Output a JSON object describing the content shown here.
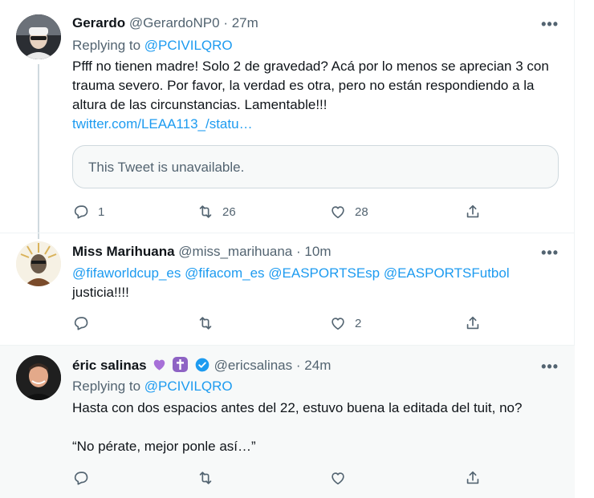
{
  "tweets": [
    {
      "name": "Gerardo",
      "handle": "@GerardoNP0",
      "time": "27m",
      "dot": "·",
      "more": "•••",
      "replying_label": "Replying to",
      "replying_to": "@PCIVILQRO",
      "text": "Pfff no tienen madre! Solo 2 de gravedad? Acá por lo menos se aprecian 3 con trauma severo. Por favor, la verdad es otra, pero no están respondiendo a la altura de las circunstancias. Lamentable!!!",
      "link": "twitter.com/LEAA113_/statu…",
      "quoted": "This Tweet is unavailable.",
      "replies": "1",
      "retweets": "26",
      "likes": "28"
    },
    {
      "name": "Miss Marihuana",
      "handle": "@miss_marihuana",
      "time": "10m",
      "dot": "·",
      "more": "•••",
      "mentions": "@fifaworldcup_es @fifacom_es @EASPORTSEsp @EASPORTSFutbol",
      "text": "justicia!!!!",
      "replies": "",
      "retweets": "",
      "likes": "2"
    },
    {
      "name": "éric salinas",
      "handle": "@ericsalinas",
      "time": "24m",
      "dot": "·",
      "more": "•••",
      "replying_label": "Replying to",
      "replying_to": "@PCIVILQRO",
      "text": "Hasta con dos espacios antes del 22, estuvo buena la editada del tuit, no?",
      "text2": "“No pérate, mejor ponle así…”",
      "replies": "",
      "retweets": "",
      "likes": ""
    }
  ],
  "colors": {
    "link": "#1d9bf0",
    "secondary": "#536471",
    "highlight_bg": "#f7f9f9",
    "purple_heart": "#a770d8",
    "cross_badge": "#8e63c4",
    "verified": "#1d9bf0"
  },
  "icons": [
    "reply-icon",
    "retweet-icon",
    "like-icon",
    "share-icon",
    "more-icon",
    "purple-heart-icon",
    "latin-cross-icon",
    "verified-badge-icon"
  ]
}
